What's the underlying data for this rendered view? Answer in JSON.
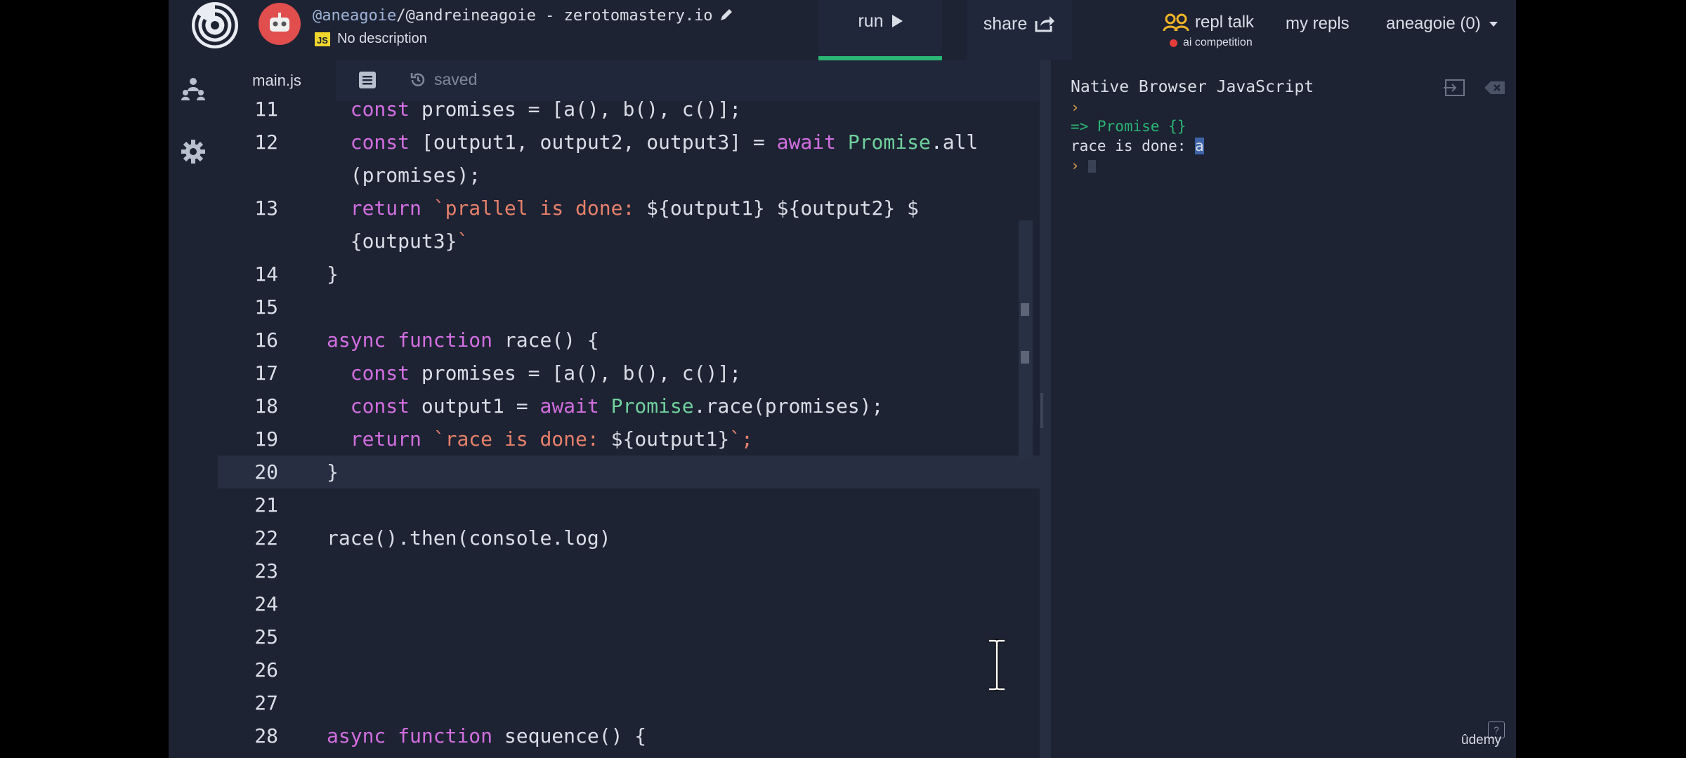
{
  "header": {
    "owner": "@aneagoie",
    "repl_path": "/@andreineagoie - zerotomastery.io",
    "language_badge": "JS",
    "description": "No description",
    "run_label": "run",
    "share_label": "share",
    "repl_talk_label": "repl talk",
    "ai_competition_label": "ai competition",
    "my_repls_label": "my repls",
    "user_label": "aneagoie (0)"
  },
  "editor": {
    "tab_file": "main.js",
    "saved_label": "saved",
    "current_line": 20,
    "lines": [
      {
        "n": "11",
        "text": "  const promises = [a(), b(), c()];"
      },
      {
        "n": "12",
        "text": "  const [output1, output2, output3] = await Promise.all"
      },
      {
        "n": "",
        "text": "  (promises);"
      },
      {
        "n": "13",
        "text": "  return `prallel is done: ${output1} ${output2} $"
      },
      {
        "n": "",
        "text": "  {output3}`"
      },
      {
        "n": "14",
        "text": "}"
      },
      {
        "n": "15",
        "text": ""
      },
      {
        "n": "16",
        "text": "async function race() {"
      },
      {
        "n": "17",
        "text": "  const promises = [a(), b(), c()];"
      },
      {
        "n": "18",
        "text": "  const output1 = await Promise.race(promises);"
      },
      {
        "n": "19",
        "text": "  return `race is done: ${output1}`;"
      },
      {
        "n": "20",
        "text": "}"
      },
      {
        "n": "21",
        "text": ""
      },
      {
        "n": "22",
        "text": "race().then(console.log)"
      },
      {
        "n": "23",
        "text": ""
      },
      {
        "n": "24",
        "text": ""
      },
      {
        "n": "25",
        "text": ""
      },
      {
        "n": "26",
        "text": ""
      },
      {
        "n": "27",
        "text": ""
      },
      {
        "n": "28",
        "text": "async function sequence() {"
      }
    ]
  },
  "console": {
    "title": "Native Browser JavaScript",
    "prompt_symbol": "›",
    "return_line": "=> Promise {}",
    "output_prefix": "race is done: ",
    "output_value": "a"
  },
  "watermark": {
    "brand": "ûdemy",
    "help": "?"
  },
  "colors": {
    "background": "#1d2333",
    "accent_green": "#2bb673",
    "keyword": "#d26ee0",
    "string": "#e7806a",
    "class": "#6fd19c",
    "avatar": "#e04e4e",
    "js_badge": "#f0d52c"
  }
}
